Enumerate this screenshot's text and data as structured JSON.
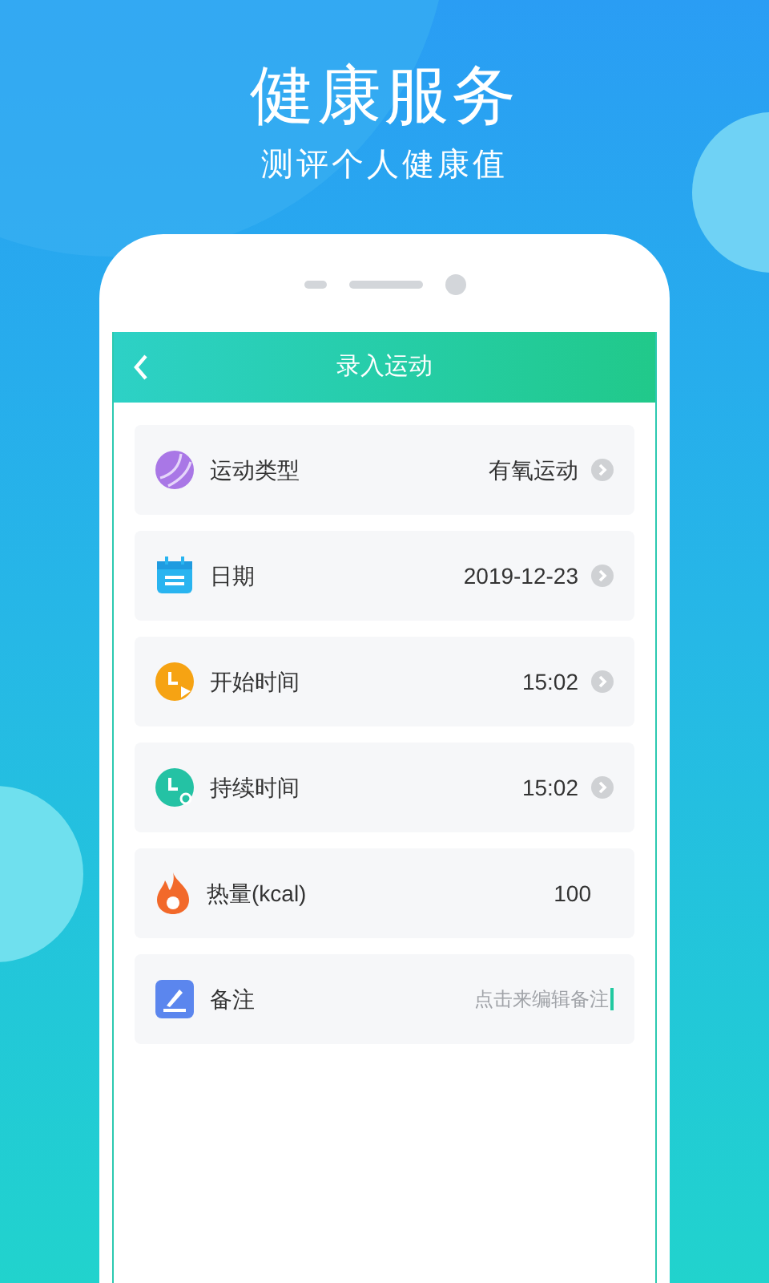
{
  "headline": "健康服务",
  "subtitle": "测评个人健康值",
  "screen": {
    "title": "录入运动",
    "rows": [
      {
        "kind": "select",
        "label": "运动类型",
        "value": "有氧运动"
      },
      {
        "kind": "select",
        "label": "日期",
        "value": "2019-12-23"
      },
      {
        "kind": "select",
        "label": "开始时间",
        "value": "15:02"
      },
      {
        "kind": "select",
        "label": "持续时间",
        "value": "15:02"
      },
      {
        "kind": "value",
        "label": "热量(kcal)",
        "value": "100"
      },
      {
        "kind": "note",
        "label": "备注",
        "placeholder": "点击来编辑备注"
      }
    ]
  }
}
